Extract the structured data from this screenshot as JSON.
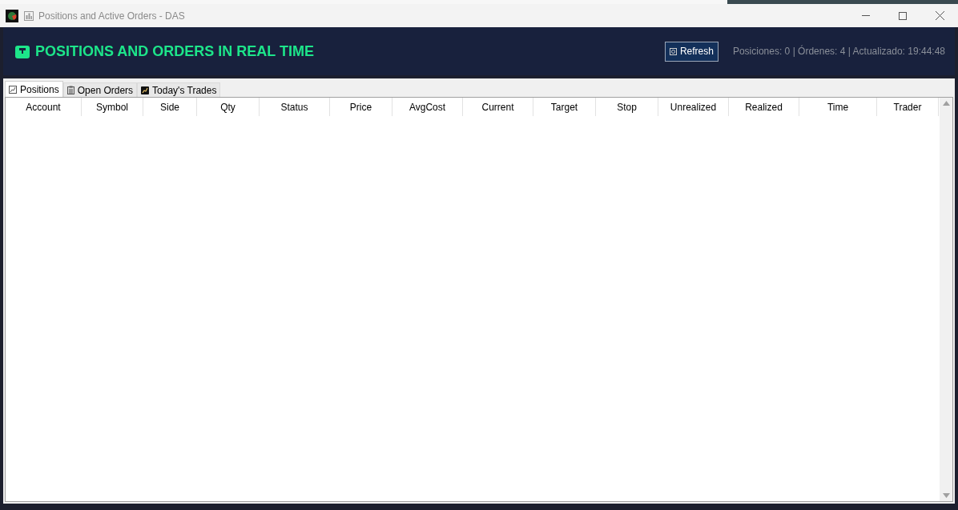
{
  "window": {
    "title": "Positions and Active Orders - DAS"
  },
  "header": {
    "title": "POSITIONS AND ORDERS IN REAL TIME",
    "refresh_button": "Refresh",
    "status": "Posiciones: 0 | Órdenes: 4 | Actualizado: 19:44:48"
  },
  "tabs": [
    {
      "label": "Positions",
      "selected": true,
      "kind": "chart"
    },
    {
      "label": "Open Orders",
      "selected": false,
      "kind": "clipboard"
    },
    {
      "label": "Today's Trades",
      "selected": false,
      "kind": "trades"
    }
  ],
  "table": {
    "columns": [
      "Account",
      "Symbol",
      "Side",
      "Qty",
      "Status",
      "Price",
      "AvgCost",
      "Current",
      "Target",
      "Stop",
      "Unrealized",
      "Realized",
      "Time",
      "Trader"
    ]
  }
}
